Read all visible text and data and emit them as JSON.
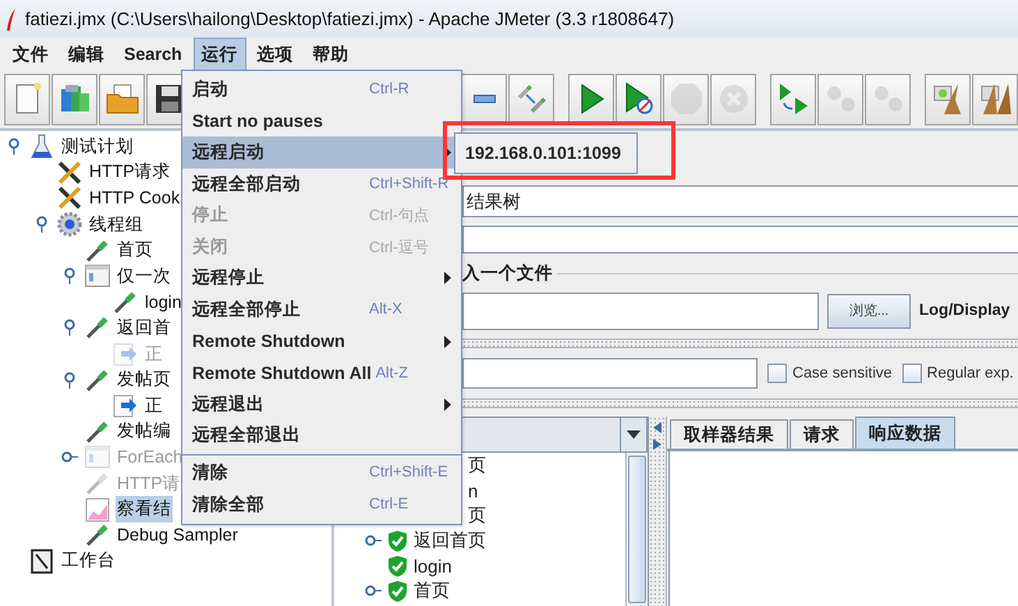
{
  "window": {
    "title": "fatiezi.jmx (C:\\Users\\hailong\\Desktop\\fatiezi.jmx) - Apache JMeter (3.3 r1808647)"
  },
  "menu_bar": [
    {
      "label": "文件",
      "selected": false
    },
    {
      "label": "编辑",
      "selected": false
    },
    {
      "label": "Search",
      "selected": false
    },
    {
      "label": "运行",
      "selected": true
    },
    {
      "label": "选项",
      "selected": false
    },
    {
      "label": "帮助",
      "selected": false
    }
  ],
  "toolbar": {
    "groups": [
      [
        {
          "kind": "new",
          "disabled": false
        },
        {
          "kind": "templates",
          "disabled": false
        },
        {
          "kind": "open",
          "disabled": false
        },
        {
          "kind": "save",
          "disabled": false
        }
      ],
      [
        {
          "kind": "collapse",
          "disabled": false
        },
        {
          "kind": "toggle",
          "disabled": false
        }
      ],
      [
        {
          "kind": "start",
          "disabled": false
        },
        {
          "kind": "start-no-pause",
          "disabled": false
        },
        {
          "kind": "stop",
          "disabled": true
        },
        {
          "kind": "shutdown",
          "disabled": true
        }
      ],
      [
        {
          "kind": "remote-start-all",
          "disabled": false
        },
        {
          "kind": "remote-stop-all",
          "disabled": true
        },
        {
          "kind": "remote-shutdown-all",
          "disabled": true
        }
      ],
      [
        {
          "kind": "clear",
          "disabled": false
        },
        {
          "kind": "clear-all",
          "disabled": false
        }
      ]
    ]
  },
  "tree": [
    {
      "label": "测试计划",
      "kind": "plan",
      "selected": false,
      "disabled": false,
      "expanded": true,
      "children": [
        {
          "label": "HTTP请求",
          "kind": "config",
          "selected": false,
          "disabled": false
        },
        {
          "label": "HTTP Cook",
          "kind": "config",
          "selected": false,
          "disabled": false
        },
        {
          "label": "线程组",
          "kind": "threadgroup",
          "selected": false,
          "disabled": false,
          "expanded": true,
          "children": [
            {
              "label": "首页",
              "kind": "sampler",
              "selected": false,
              "disabled": false
            },
            {
              "label": "仅一次",
              "kind": "controller",
              "selected": false,
              "disabled": false,
              "expanded": true,
              "children": [
                {
                  "label": "login",
                  "kind": "sampler",
                  "selected": false,
                  "disabled": false
                }
              ]
            },
            {
              "label": "返回首",
              "kind": "sampler",
              "selected": false,
              "disabled": false,
              "expanded": true,
              "children": [
                {
                  "label": "正",
                  "kind": "extractor",
                  "selected": false,
                  "disabled": true
                }
              ]
            },
            {
              "label": "发帖页",
              "kind": "sampler",
              "selected": false,
              "disabled": false,
              "expanded": true,
              "children": [
                {
                  "label": "正",
                  "kind": "extractor",
                  "selected": false,
                  "disabled": false
                }
              ]
            },
            {
              "label": "发帖编",
              "kind": "sampler",
              "selected": false,
              "disabled": false
            },
            {
              "label": "ForEach",
              "kind": "controller",
              "selected": false,
              "disabled": true,
              "expanded": false
            },
            {
              "label": "HTTP请",
              "kind": "sampler",
              "selected": false,
              "disabled": true
            },
            {
              "label": "察看结",
              "kind": "listener",
              "selected": true,
              "disabled": false
            },
            {
              "label": "Debug Sampler",
              "kind": "sampler",
              "selected": false,
              "disabled": false
            }
          ]
        }
      ]
    },
    {
      "label": "工作台",
      "kind": "workbench",
      "selected": false,
      "disabled": false
    }
  ],
  "listener": {
    "name_field": {
      "value": "结果树"
    },
    "file_group": {
      "legend": "入一个文件",
      "browse_button": "浏览...",
      "log_label": "Log/Display"
    },
    "search": {
      "options": [
        {
          "label": "Case sensitive",
          "checked": false
        },
        {
          "label": "Regular exp.",
          "checked": false
        }
      ]
    },
    "results": [
      {
        "kind": "partial",
        "label": "页"
      },
      {
        "kind": "partial",
        "label": "n"
      },
      {
        "kind": "partial",
        "label": "页"
      },
      {
        "kind": "sample",
        "label": "返回首页",
        "expandable": true
      },
      {
        "kind": "sample",
        "label": "login",
        "expandable": false
      },
      {
        "kind": "sample",
        "label": "首页",
        "expandable": true
      }
    ],
    "tabs": [
      {
        "label": "取样器结果",
        "selected": false
      },
      {
        "label": "请求",
        "selected": false
      },
      {
        "label": "响应数据",
        "selected": true
      }
    ]
  },
  "run_menu": [
    {
      "kind": "item",
      "label": "启动",
      "shortcut": "Ctrl-R",
      "disabled": false,
      "selected": false,
      "submenu": false
    },
    {
      "kind": "item",
      "label": "Start no pauses",
      "disabled": false,
      "selected": false,
      "submenu": false
    },
    {
      "kind": "item",
      "label": "远程启动",
      "disabled": false,
      "selected": true,
      "submenu": true
    },
    {
      "kind": "item",
      "label": "远程全部启动",
      "shortcut": "Ctrl+Shift-R",
      "disabled": false,
      "selected": false,
      "submenu": false
    },
    {
      "kind": "item",
      "label": "停止",
      "shortcut": "Ctrl-句点",
      "disabled": true,
      "selected": false,
      "submenu": false
    },
    {
      "kind": "item",
      "label": "关闭",
      "shortcut": "Ctrl-逗号",
      "disabled": true,
      "selected": false,
      "submenu": false
    },
    {
      "kind": "item",
      "label": "远程停止",
      "disabled": false,
      "selected": false,
      "submenu": true
    },
    {
      "kind": "item",
      "label": "远程全部停止",
      "shortcut": "Alt-X",
      "disabled": false,
      "selected": false,
      "submenu": false
    },
    {
      "kind": "item",
      "label": "Remote Shutdown",
      "disabled": false,
      "selected": false,
      "submenu": true
    },
    {
      "kind": "item",
      "label": "Remote Shutdown All",
      "shortcut": "Alt-Z",
      "disabled": false,
      "selected": false,
      "submenu": false
    },
    {
      "kind": "item",
      "label": "远程退出",
      "disabled": false,
      "selected": false,
      "submenu": true
    },
    {
      "kind": "item",
      "label": "远程全部退出",
      "disabled": false,
      "selected": false,
      "submenu": false
    },
    {
      "kind": "separator"
    },
    {
      "kind": "item",
      "label": "清除",
      "shortcut": "Ctrl+Shift-E",
      "disabled": false,
      "selected": false,
      "submenu": false
    },
    {
      "kind": "item",
      "label": "清除全部",
      "shortcut": "Ctrl-E",
      "disabled": false,
      "selected": false,
      "submenu": false
    }
  ],
  "submenu": [
    {
      "label": "192.168.0.101:1099"
    }
  ]
}
